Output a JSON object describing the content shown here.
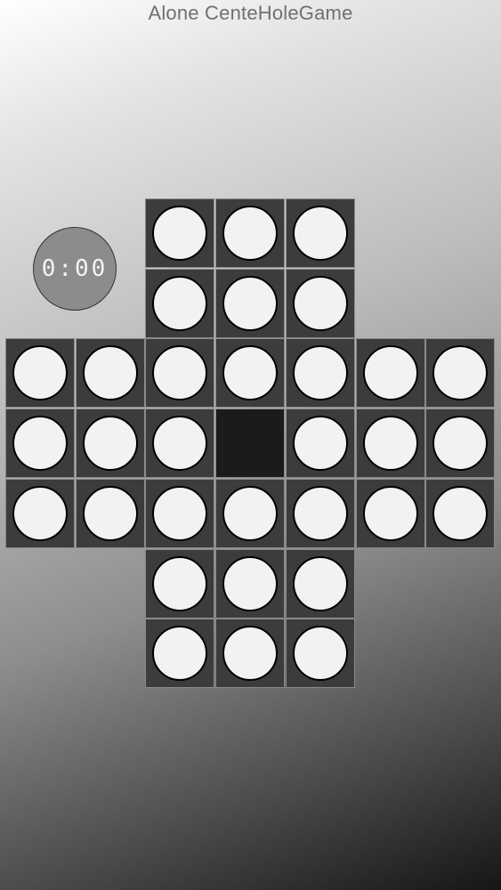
{
  "header": {
    "title": "Alone CenteHoleGame"
  },
  "timer": {
    "value": "0:00"
  },
  "board": {
    "rows": [
      "..OOO..",
      "..OOO..",
      "OOOOOOO",
      "OOO.OOO",
      "OOOOOOO",
      "..OOO..",
      "..OOO.."
    ],
    "shape": "english-cross",
    "peg_color": "#f2f2f2",
    "hole_color": "#3c3c3c",
    "empty_hole_color": "#1b1b1b"
  }
}
